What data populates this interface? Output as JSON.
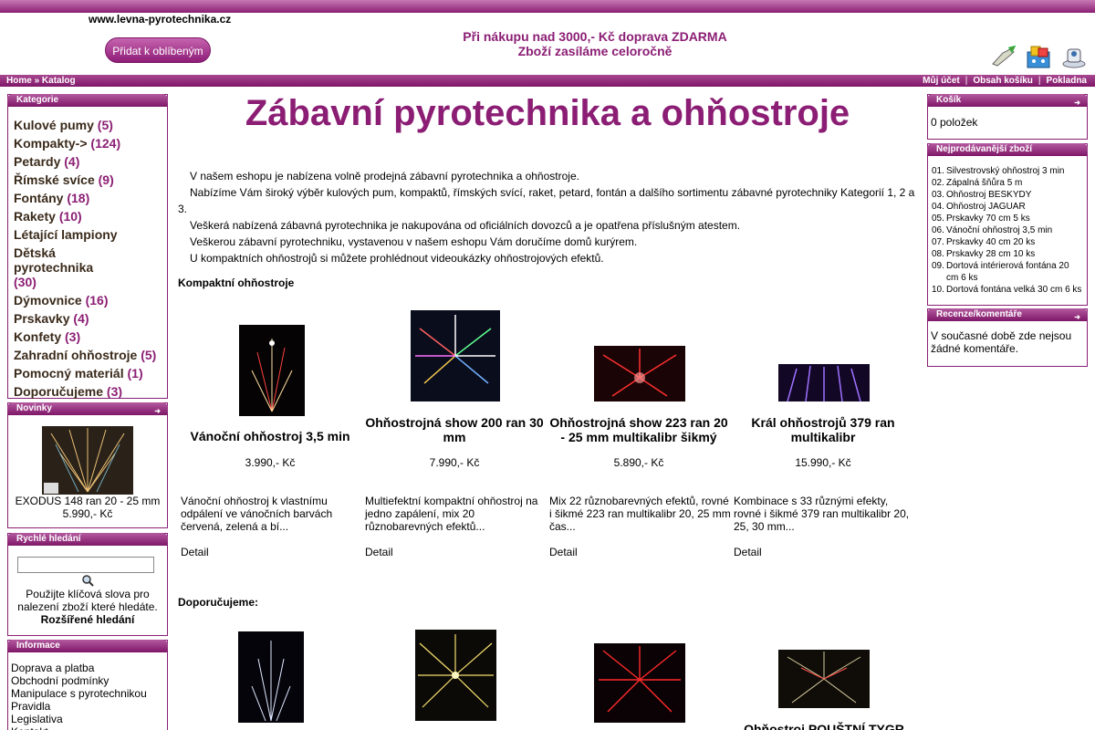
{
  "header": {
    "site_url": "www.levna-pyrotechnika.cz",
    "fav_button": "Přidat k oblíbeným",
    "promo_line1": "Při nákupu nad 3000,- Kč doprava ZDARMA",
    "promo_line2": "Zboží zasíláme celoročně",
    "icons": [
      "account-icon",
      "cart-icon",
      "checkout-icon"
    ]
  },
  "nav": {
    "home": "Home",
    "sep": "»",
    "catalog": "Katalog",
    "my_account": "Můj účet",
    "cart_contents": "Obsah košíku",
    "checkout": "Pokladna",
    "divider": "|"
  },
  "categories": {
    "title": "Kategorie",
    "items": [
      {
        "label": "Kulové pumy",
        "count": "(5)"
      },
      {
        "label": "Kompakty->",
        "count": "(124)"
      },
      {
        "label": "Petardy",
        "count": "(4)"
      },
      {
        "label": "Římské svíce",
        "count": "(9)"
      },
      {
        "label": "Fontány",
        "count": "(18)"
      },
      {
        "label": "Rakety",
        "count": "(10)"
      },
      {
        "label": "Létající lampiony",
        "count": ""
      },
      {
        "label": "Dětská pyrotechnika",
        "count": "(30)"
      },
      {
        "label": "Dýmovnice",
        "count": "(16)"
      },
      {
        "label": "Prskavky",
        "count": "(4)"
      },
      {
        "label": "Konfety",
        "count": "(3)"
      },
      {
        "label": "Zahradní ohňostroje",
        "count": "(5)"
      },
      {
        "label": "Pomocný materiál",
        "count": "(1)"
      },
      {
        "label": "Doporučujeme",
        "count": "(3)"
      }
    ]
  },
  "novinky": {
    "title": "Novinky",
    "product": "EXODUS 148 ran 20 - 25 mm",
    "price": "5.990,- Kč"
  },
  "search": {
    "title": "Rychlé hledání",
    "value": "",
    "hint": "Použijte klíčová slova pro nalezení zboží které hledáte.",
    "advanced": "Rozšířené hledání"
  },
  "info": {
    "title": "Informace",
    "items": [
      "Doprava a platba",
      "Obchodní podmínky",
      "Manipulace s pyrotechnikou",
      "Pravidla",
      "Legislativa",
      "Kontakt"
    ]
  },
  "main": {
    "title": "Zábavní pyrotechnika a ohňostroje",
    "intro": [
      "V našem eshopu je nabízena volně prodejná zábavní pyrotechnika a ohňostroje.",
      "Nabízíme Vám široký výběr kulových pum, kompaktů, římských svící, raket, petard, fontán a dalšího sortimentu zábavné pyrotechniky Kategorií 1, 2 a 3.",
      "Veškerá nabízená zábavná pyrotechnika je nakupována od oficiálních dovozců a je opatřena příslušným atestem.",
      "Veškerou zábavní pyrotechniku, vystavenou v našem eshopu Vám doručíme domů kurýrem.",
      "U kompaktních ohňostrojů si můžete prohlédnout videoukázky ohňostrojových efektů."
    ],
    "compact_heading": "Kompaktní ohňostroje",
    "products": [
      {
        "name": "Vánoční ohňostroj 3,5 min",
        "price": "3.990,- Kč",
        "desc": "Vánoční ohňostroj k vlastnímu odpálení ve vánočních barvách červená, zelená a bí...",
        "detail": "Detail"
      },
      {
        "name": "Ohňostrojná show 200 ran 30 mm",
        "price": "7.990,- Kč",
        "desc": "Multiefektní kompaktní ohňostroj na jedno zapálení, mix 20 různobarevných efektů...",
        "detail": "Detail"
      },
      {
        "name": "Ohňostrojná show 223 ran 20 - 25 mm multikalibr šikmý",
        "price": "5.890,- Kč",
        "desc": "Mix 22 různobarevných efektů, rovné i šikmé 223 ran multikalibr 20, 25 mm čas...",
        "detail": "Detail"
      },
      {
        "name": "Král ohňostrojů 379 ran multikalibr",
        "price": "15.990,- Kč",
        "desc": "Kombinace s 33 různými efekty, rovné i šikmé 379 ran multikalibr 20, 25, 30 mm...",
        "detail": "Detail"
      }
    ],
    "recommend_heading": "Doporučujeme:",
    "recommend_visible_name": "Ohňostroj POUŠTNÍ TYGR"
  },
  "cart": {
    "title": "Košík",
    "content": "0 položek"
  },
  "bestsellers": {
    "title": "Nejprodávanější zboží",
    "items": [
      {
        "n": "01.",
        "label": "Silvestrovský ohňostroj 3 min"
      },
      {
        "n": "02.",
        "label": "Zápalná šňůra 5 m"
      },
      {
        "n": "03.",
        "label": "Ohňostroj BESKYDY"
      },
      {
        "n": "04.",
        "label": "Ohňostroj JAGUAR"
      },
      {
        "n": "05.",
        "label": "Prskavky 70 cm 5 ks"
      },
      {
        "n": "06.",
        "label": "Vánoční ohňostroj 3,5 min"
      },
      {
        "n": "07.",
        "label": "Prskavky 40 cm 20 ks"
      },
      {
        "n": "08.",
        "label": "Prskavky 28 cm 10 ks"
      },
      {
        "n": "09.",
        "label": "Dortová intérierová fontána 20 cm 6 ks"
      },
      {
        "n": "10.",
        "label": "Dortová fontána velká 30 cm 6 ks"
      }
    ]
  },
  "reviews": {
    "title": "Recenze/komentáře",
    "content": "V současné době zde nejsou žádné komentáře."
  },
  "colors": {
    "brand": "#8b1e74"
  }
}
